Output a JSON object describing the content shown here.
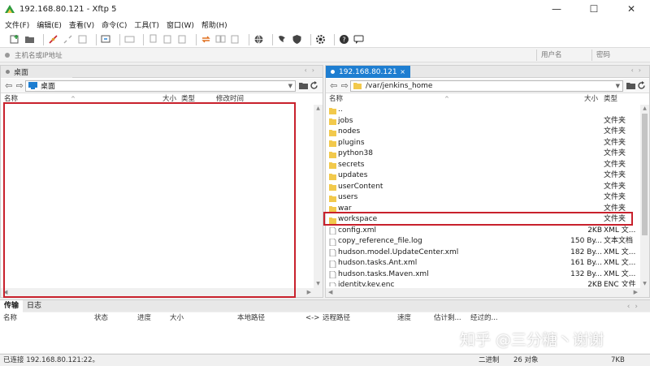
{
  "window": {
    "title": "192.168.80.121 - Xftp 5",
    "minimize": "—",
    "maximize": "☐",
    "close": "✕"
  },
  "menu": [
    "文件(F)",
    "编辑(E)",
    "查看(V)",
    "命令(C)",
    "工具(T)",
    "窗口(W)",
    "帮助(H)"
  ],
  "address": {
    "placeholder": "主机名或IP地址",
    "user_placeholder": "用户名",
    "pass_placeholder": "密码"
  },
  "left_pane": {
    "tab_label": "桌面",
    "path": "桌面",
    "columns": {
      "name": "名称",
      "size": "大小",
      "type": "类型",
      "modified": "修改时间"
    }
  },
  "right_pane": {
    "tab_label": "192.168.80.121",
    "path": "/var/jenkins_home",
    "columns": {
      "name": "名称",
      "size": "大小",
      "type": "类型"
    },
    "files": [
      {
        "name": "..",
        "size": "",
        "type": "",
        "kind": "folder"
      },
      {
        "name": "jobs",
        "size": "",
        "type": "文件夹",
        "kind": "folder"
      },
      {
        "name": "nodes",
        "size": "",
        "type": "文件夹",
        "kind": "folder"
      },
      {
        "name": "plugins",
        "size": "",
        "type": "文件夹",
        "kind": "folder"
      },
      {
        "name": "python38",
        "size": "",
        "type": "文件夹",
        "kind": "folder"
      },
      {
        "name": "secrets",
        "size": "",
        "type": "文件夹",
        "kind": "folder"
      },
      {
        "name": "updates",
        "size": "",
        "type": "文件夹",
        "kind": "folder"
      },
      {
        "name": "userContent",
        "size": "",
        "type": "文件夹",
        "kind": "folder"
      },
      {
        "name": "users",
        "size": "",
        "type": "文件夹",
        "kind": "folder"
      },
      {
        "name": "war",
        "size": "",
        "type": "文件夹",
        "kind": "folder"
      },
      {
        "name": "workspace",
        "size": "",
        "type": "文件夹",
        "kind": "folder"
      },
      {
        "name": "config.xml",
        "size": "2KB",
        "type": "XML 文...",
        "kind": "file"
      },
      {
        "name": "copy_reference_file.log",
        "size": "150 By...",
        "type": "文本文档",
        "kind": "file"
      },
      {
        "name": "hudson.model.UpdateCenter.xml",
        "size": "182 By...",
        "type": "XML 文...",
        "kind": "file"
      },
      {
        "name": "hudson.tasks.Ant.xml",
        "size": "161 By...",
        "type": "XML 文...",
        "kind": "file"
      },
      {
        "name": "hudson.tasks.Maven.xml",
        "size": "132 By...",
        "type": "XML 文...",
        "kind": "file"
      },
      {
        "name": "identity.key.enc",
        "size": "2KB",
        "type": "ENC 文件",
        "kind": "file"
      }
    ]
  },
  "transfer": {
    "tab_transfer": "传输",
    "tab_log": "日志",
    "columns": {
      "name": "名称",
      "status": "状态",
      "progress": "进度",
      "size": "大小",
      "local_path": "本地路径",
      "direction": "<->",
      "remote_path": "远程路径",
      "speed": "速度",
      "eta": "估计剩...",
      "elapsed": "经过的..."
    }
  },
  "status": {
    "connection": "已连接 192.168.80.121:22。",
    "mode": "二进制",
    "objects": "26 对象",
    "size": "7KB"
  },
  "watermark": "知乎 @三分糖丶谢谢",
  "colors": {
    "accent": "#1e7ed1",
    "highlight_box": "#c8212c",
    "folder": "#f2c94c"
  }
}
